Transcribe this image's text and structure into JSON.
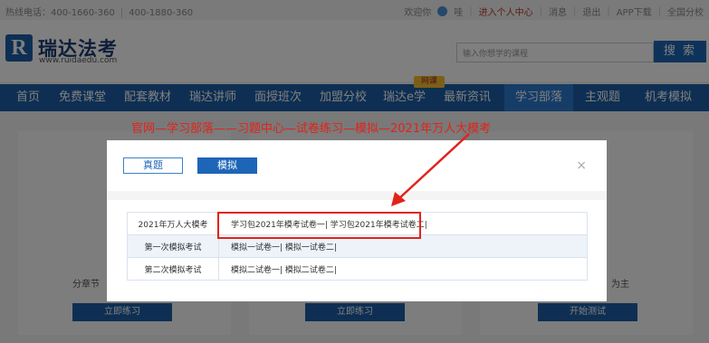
{
  "topbar": {
    "hotline1": "热线电话：400-1660-360",
    "hotline2": "400-1880-360",
    "welcome": "欢迎你",
    "user": "哇",
    "personal_center": "进入个人中心",
    "messages": "消息",
    "logout": "退出",
    "app_download": "APP下载",
    "national_sites": "全国分校"
  },
  "header": {
    "logo_mark": "R",
    "logo_name": "瑞达法考",
    "logo_url": "www.ruidaedu.com",
    "search_placeholder": "输入你想学的课程",
    "search_button": "搜 索"
  },
  "nav": {
    "items": [
      "首页",
      "免费课堂",
      "配套教材",
      "瑞达讲师",
      "面授班次",
      "加盟分校",
      "瑞达e学",
      "最新资讯",
      "学习部落",
      "主观题",
      "机考模拟"
    ],
    "badge": "网课",
    "active_index": 8
  },
  "annotation": "官网—学习部落——习题中心—试卷练习—模拟—2021年万人大模考",
  "background": {
    "btn1": "立即练习",
    "btn2": "立即练习",
    "btn3": "开始测试",
    "snippet_left": "分章节",
    "snippet_right": "为主"
  },
  "modal": {
    "tab_real": "真题",
    "tab_mock": "模拟",
    "close": "×",
    "rows": [
      {
        "name": "2021年万人大模考",
        "papers": "学习包2021年模考试卷一| 学习包2021年模考试卷二|"
      },
      {
        "name": "第一次模拟考试",
        "papers": "模拟一试卷一| 模拟一试卷二|"
      },
      {
        "name": "第二次模拟考试",
        "papers": "模拟二试卷一| 模拟二试卷二|"
      }
    ]
  },
  "colors": {
    "nav_blue": "#1d5fa6",
    "accent_red": "#e2231a",
    "brand_blue": "#1c5fa8"
  }
}
